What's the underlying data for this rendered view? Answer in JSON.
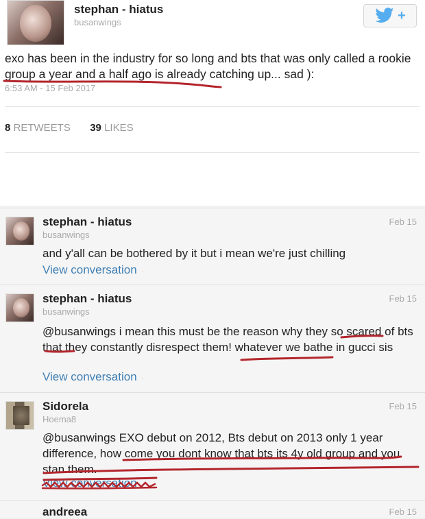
{
  "main_tweet": {
    "author_name": "stephan - hiatus",
    "handle": "busanwings",
    "text": "exo has been in the industry for so long and bts that was only called a rookie group a year and a half ago is already catching up... sad ):",
    "timestamp": "6:53 AM - 15 Feb 2017",
    "retweets_count": "8",
    "retweets_label": "RETWEETS",
    "likes_count": "39",
    "likes_label": "LIKES",
    "follow_icon": "bird-plus-icon"
  },
  "replies": [
    {
      "author_name": "stephan - hiatus",
      "handle": "busanwings",
      "date": "Feb 15",
      "text": "and y'all can be bothered by it but i mean we're just chilling",
      "link": "View conversation"
    },
    {
      "author_name": "stephan - hiatus",
      "handle": "busanwings",
      "date": "Feb 15",
      "text": "@busanwings i mean this must be the reason why they so scared of bts that they constantly disrespect them! whatever we bathe in gucci sis",
      "link": "View conversation"
    },
    {
      "author_name": "Sidorela",
      "handle": "Hoema8",
      "date": "Feb 15",
      "text": "@busanwings EXO debut on 2012, Bts debut on 2013 only 1 year difference, how come you dont know that bts its 4y old group and you stan them.",
      "link": "View conversation"
    },
    {
      "author_name": "andreea",
      "date": "Feb 15"
    }
  ],
  "colors": {
    "link": "#3f7fb4",
    "annotation": "#b3262c",
    "twitter_blue": "#55acee"
  }
}
